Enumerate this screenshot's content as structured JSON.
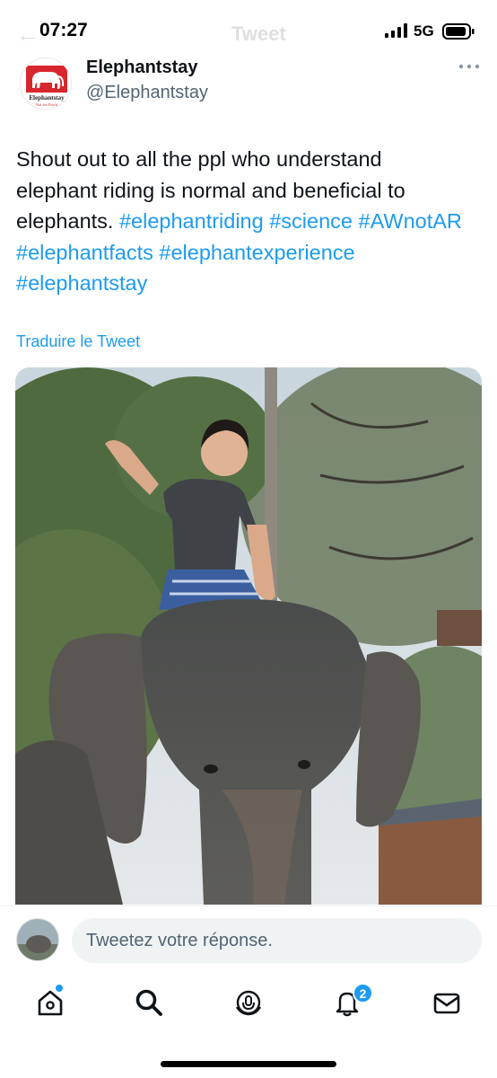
{
  "status_bar": {
    "time": "07:27",
    "network": "5G",
    "faded_title": "Tweet"
  },
  "tweet": {
    "display_name": "Elephantstay",
    "handle": "@Elephantstay",
    "avatar_text": "Elephantstay",
    "avatar_subtext": "Not for Profit",
    "text_plain": "Shout out to all the ppl who understand elephant riding is normal and beneficial to elephants. ",
    "hashtags": [
      "#elephantriding",
      "#science",
      "#AWnotAR",
      "#elephantfacts",
      "#elephantexperience",
      "#elephantstay"
    ],
    "translate_label": "Traduire le Tweet"
  },
  "reply": {
    "placeholder": "Tweetez votre réponse."
  },
  "tabs": [
    {
      "name": "home-icon"
    },
    {
      "name": "search-icon"
    },
    {
      "name": "spaces-icon"
    },
    {
      "name": "notifications-icon",
      "badge": "2"
    },
    {
      "name": "messages-icon"
    }
  ],
  "colors": {
    "accent": "#1d9bf0",
    "text": "#0f1419",
    "secondary": "#536471",
    "logo_red": "#d7262c"
  }
}
